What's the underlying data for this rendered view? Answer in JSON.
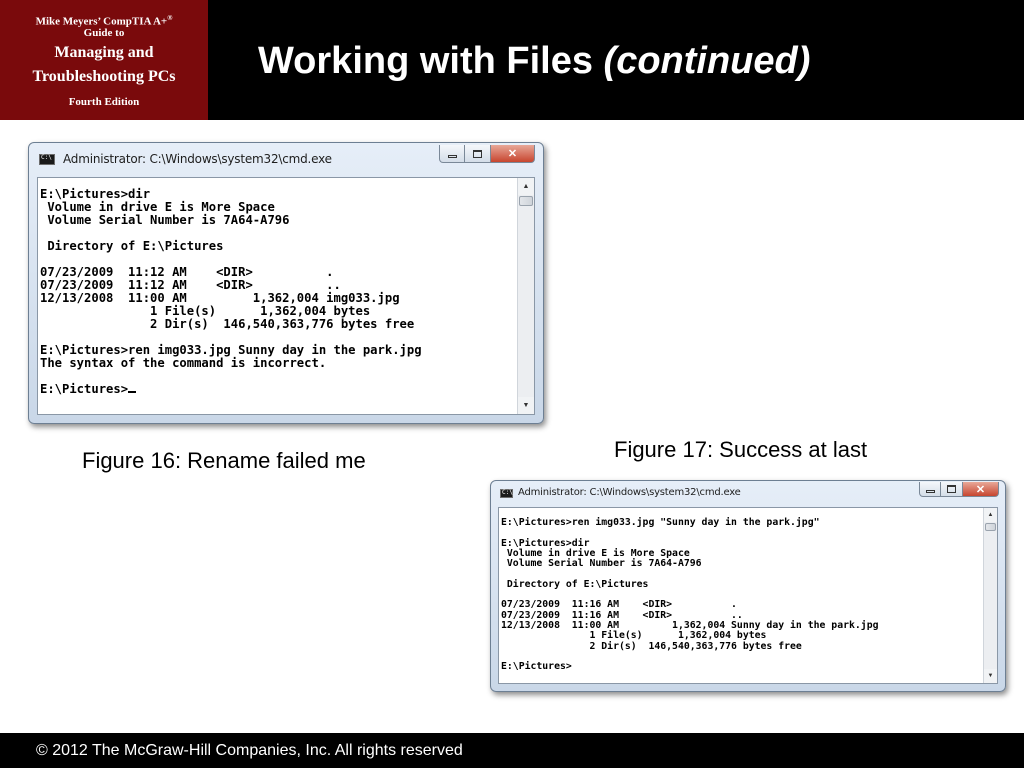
{
  "header": {
    "book": {
      "line1": "Mike Meyers’ CompTIA A+",
      "line1_mark": "®",
      "line2": "Guide to",
      "line3": "Managing and",
      "line4": "Troubleshooting PCs",
      "line5": "Fourth Edition"
    },
    "title_main": "Working with Files ",
    "title_italic": "(continued)"
  },
  "colors": {
    "header_background": "#000000",
    "badge_background": "#7a0a0c",
    "footer_background": "#000000",
    "console_background": "#ffffff"
  },
  "figure16": {
    "caption": "Figure 16: Rename failed me",
    "window": {
      "title": "Administrator: C:\\Windows\\system32\\cmd.exe",
      "icon": "cmd-icon",
      "lines": [
        "E:\\Pictures>dir",
        " Volume in drive E is More Space",
        " Volume Serial Number is 7A64-A796",
        "",
        " Directory of E:\\Pictures",
        "",
        "07/23/2009  11:12 AM    <DIR>          .",
        "07/23/2009  11:12 AM    <DIR>          ..",
        "12/13/2008  11:00 AM         1,362,004 img033.jpg",
        "               1 File(s)      1,362,004 bytes",
        "               2 Dir(s)  146,540,363,776 bytes free",
        "",
        "E:\\Pictures>ren img033.jpg Sunny day in the park.jpg",
        "The syntax of the command is incorrect.",
        "",
        "E:\\Pictures>"
      ]
    }
  },
  "figure17": {
    "caption": "Figure 17: Success at last",
    "window": {
      "title": "Administrator: C:\\Windows\\system32\\cmd.exe",
      "icon": "cmd-icon",
      "lines": [
        "E:\\Pictures>ren img033.jpg \"Sunny day in the park.jpg\"",
        "",
        "E:\\Pictures>dir",
        " Volume in drive E is More Space",
        " Volume Serial Number is 7A64-A796",
        "",
        " Directory of E:\\Pictures",
        "",
        "07/23/2009  11:16 AM    <DIR>          .",
        "07/23/2009  11:16 AM    <DIR>          ..",
        "12/13/2008  11:00 AM         1,362,004 Sunny day in the park.jpg",
        "               1 File(s)      1,362,004 bytes",
        "               2 Dir(s)  146,540,363,776 bytes free",
        "",
        "E:\\Pictures>"
      ]
    }
  },
  "footer": {
    "copyright": "© 2012 The McGraw-Hill Companies, Inc. All rights reserved"
  }
}
